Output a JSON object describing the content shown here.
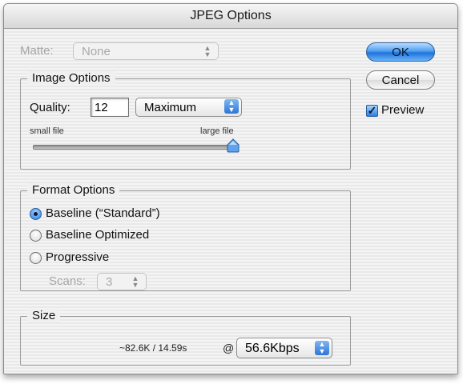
{
  "dialog": {
    "title": "JPEG Options"
  },
  "matte": {
    "label": "Matte:",
    "value": "None"
  },
  "image_options": {
    "title": "Image Options",
    "quality_label": "Quality:",
    "quality_value": "12",
    "quality_preset": "Maximum",
    "slider_min_label": "small file",
    "slider_max_label": "large file",
    "slider_position": 1.0
  },
  "buttons": {
    "ok": "OK",
    "cancel": "Cancel"
  },
  "preview": {
    "label": "Preview",
    "checked": true
  },
  "format_options": {
    "title": "Format Options",
    "options": [
      "Baseline (“Standard”)",
      "Baseline Optimized",
      "Progressive"
    ],
    "selected": 0,
    "scans_label": "Scans:",
    "scans_value": "3"
  },
  "size": {
    "title": "Size",
    "estimate": "~82.6K / 14.59s",
    "at": "@",
    "rate": "56.6Kbps"
  },
  "colors": {
    "accent": "#2f7ee0"
  }
}
